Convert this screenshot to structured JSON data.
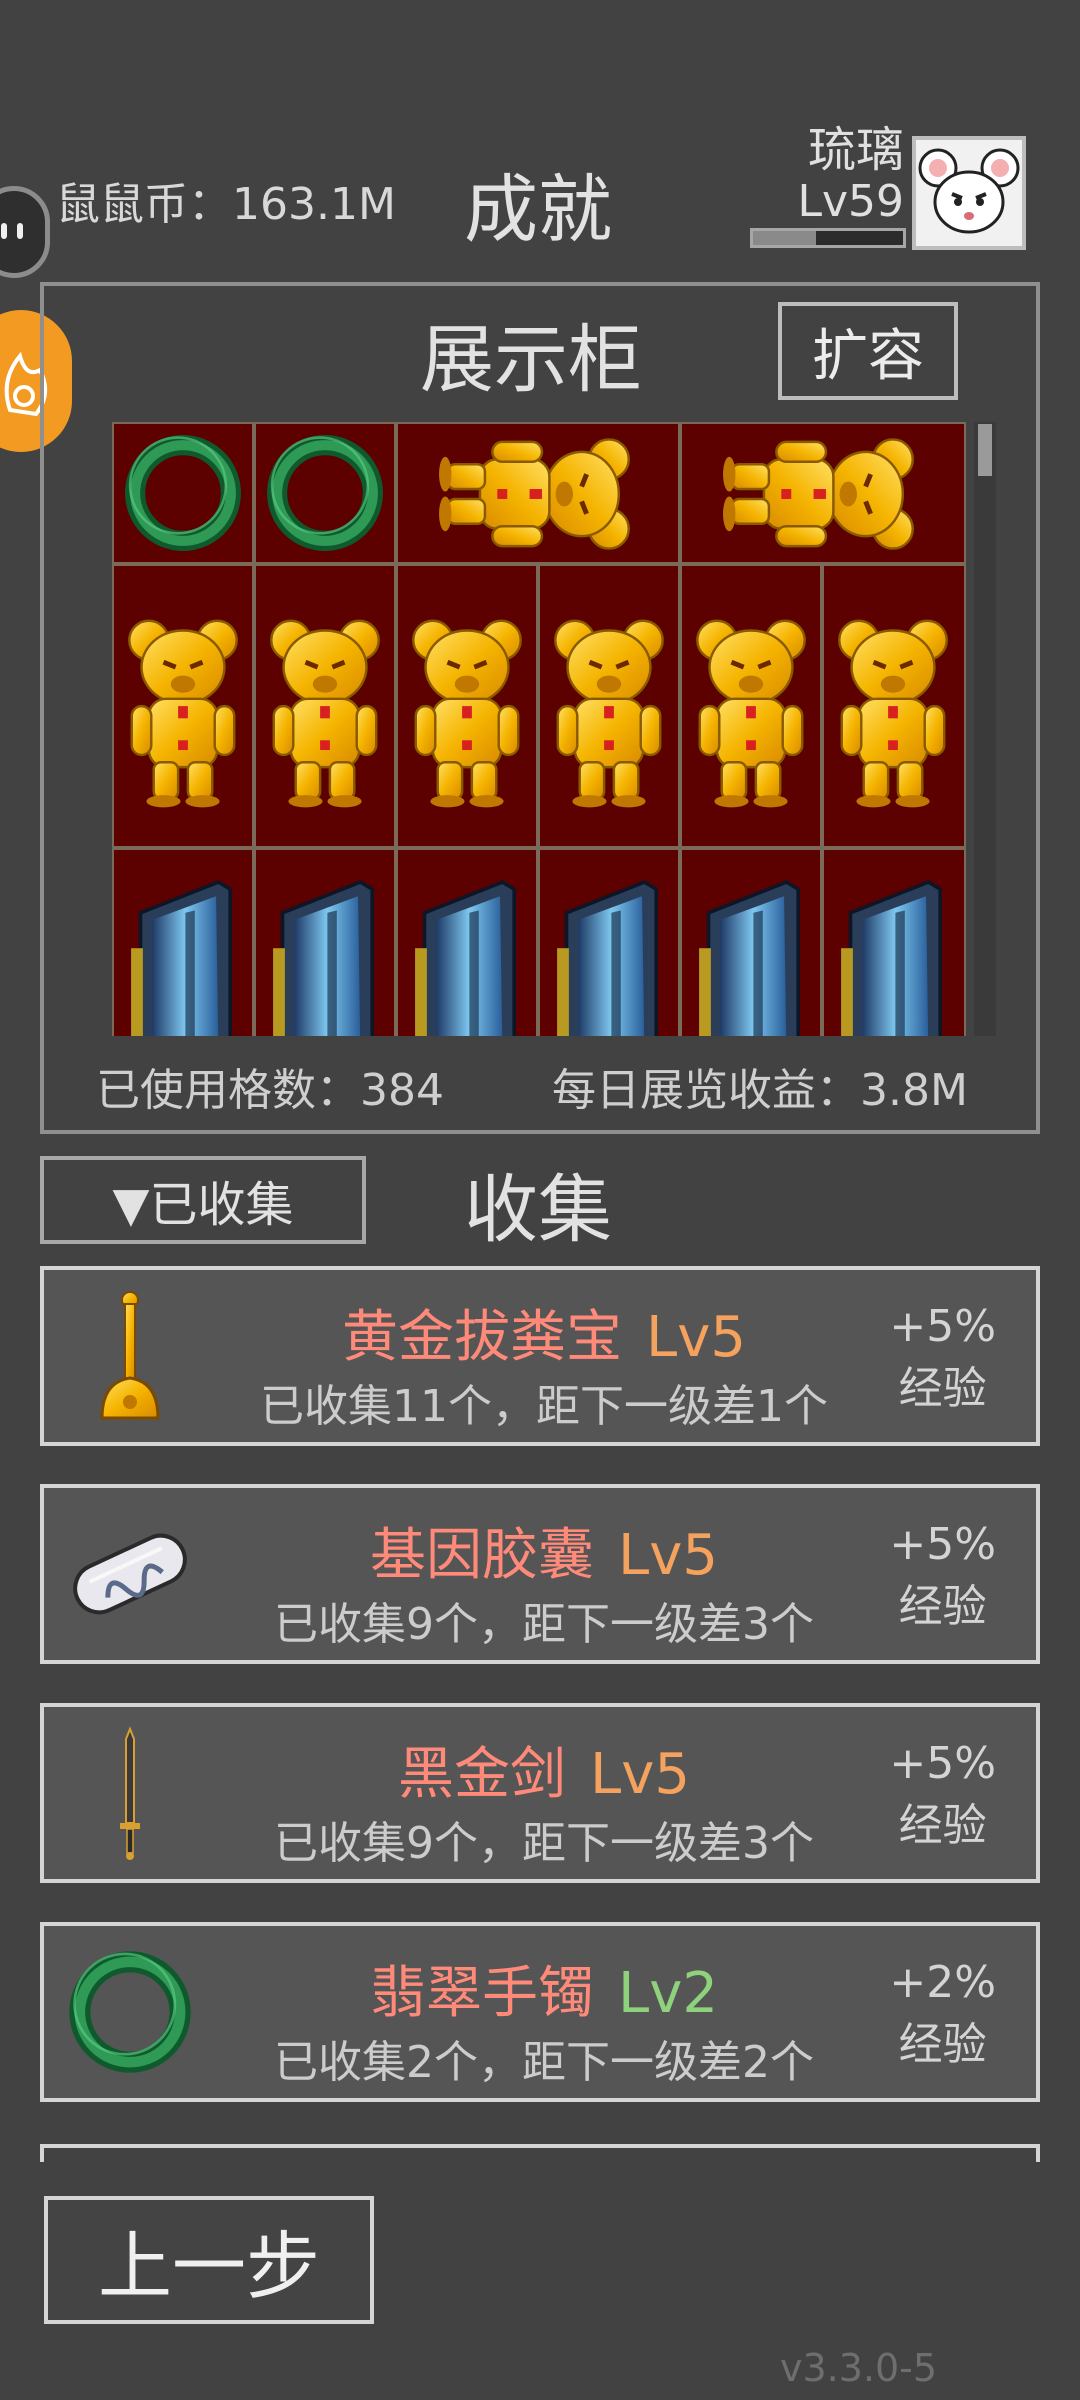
{
  "header": {
    "coins_text": "鼠鼠币：163.1M",
    "title": "成就",
    "username": "琉璃",
    "level": "Lv59",
    "xp_fraction": 0.42
  },
  "showcase": {
    "title": "展示柜",
    "expand_label": "扩容",
    "used_cells_text": "已使用格数：384",
    "daily_income_text": "每日展览收益：3.8M",
    "rows": [
      [
        "jade-bracelet",
        "jade-bracelet",
        "gold-bear-lying",
        "gold-bear-lying"
      ],
      [
        "gold-bear",
        "gold-bear",
        "gold-bear",
        "gold-bear",
        "gold-bear",
        "gold-bear"
      ],
      [
        "graphics-card",
        "graphics-card",
        "graphics-card",
        "graphics-card",
        "graphics-card",
        "graphics-card"
      ]
    ]
  },
  "collection": {
    "filter_label": "▼已收集",
    "title": "收集",
    "items": [
      {
        "icon": "golden-plunger-icon",
        "name": "黄金拔粪宝",
        "level": "Lv5",
        "progress": "已收集11个，距下一级差1个",
        "bonus": "+5%",
        "bonus_type": "经验"
      },
      {
        "icon": "gene-capsule-icon",
        "name": "基因胶囊",
        "level": "Lv5",
        "progress": "已收集9个，距下一级差3个",
        "bonus": "+5%",
        "bonus_type": "经验"
      },
      {
        "icon": "black-gold-sword-icon",
        "name": "黑金剑",
        "level": "Lv5",
        "progress": "已收集9个，距下一级差3个",
        "bonus": "+5%",
        "bonus_type": "经验"
      },
      {
        "icon": "jade-bracelet-icon",
        "name": "翡翠手镯",
        "level": "Lv2",
        "progress": "已收集2个，距下一级差2个",
        "bonus": "+2%",
        "bonus_type": "经验"
      }
    ]
  },
  "footer": {
    "back_label": "上一步",
    "version": "v3.3.0-5"
  },
  "colors": {
    "background": "#424242",
    "item_name": "#ff8a7a",
    "level_orange": "#f4a25e",
    "level_green": "#8ed27c",
    "showcase_bg": "#5c0000"
  }
}
